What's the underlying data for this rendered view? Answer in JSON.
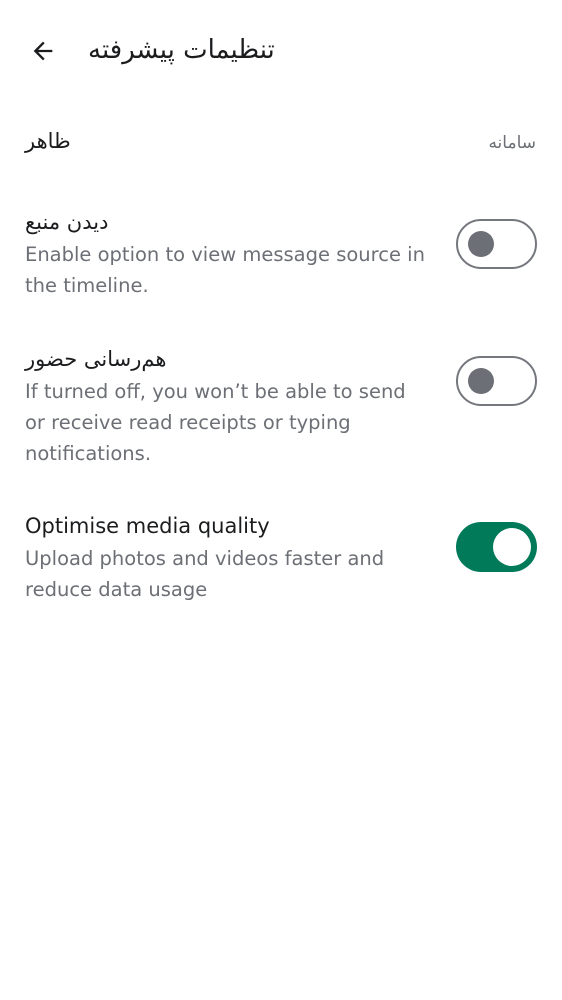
{
  "header": {
    "title": "تنظیمات پیشرفته",
    "back_icon": "arrow-left-icon"
  },
  "appearance": {
    "label": "ظاهر",
    "value": "سامانه"
  },
  "settings": [
    {
      "title": "دیدن منبع",
      "description": "Enable option to view message source in the timeline.",
      "enabled": false
    },
    {
      "title": "هم‌رسانی حضور",
      "description": "If turned off, you won’t be able to send or receive read receipts or typing notifications.",
      "enabled": false
    },
    {
      "title": "Optimise media quality",
      "description": "Upload photos and videos faster and reduce data usage",
      "enabled": true
    }
  ],
  "colors": {
    "accent": "#017a5a",
    "text_primary": "#1b1c1e",
    "text_secondary": "#6c6f75"
  }
}
